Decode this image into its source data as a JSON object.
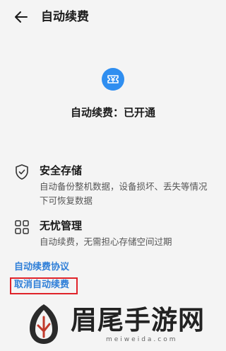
{
  "header": {
    "title": "自动续费",
    "back_icon": "arrow-left-icon"
  },
  "status": {
    "badge_icon": "ticket-yen-icon",
    "badge_color": "#2f8ef0",
    "text": "自动续费：已开通"
  },
  "features": [
    {
      "icon": "shield-check-icon",
      "title": "安全存储",
      "description": "自动备份整机数据，设备损坏、丢失等情况下可恢复数据"
    },
    {
      "icon": "grid-icon",
      "title": "无忧管理",
      "description": "自动续费，无需担心存储空间过期"
    }
  ],
  "links": {
    "agreement": "自动续费协议",
    "cancel": "取消自动续费",
    "link_color": "#2f7fd8",
    "highlight_color": "#e0232a"
  },
  "watermark": {
    "brand": "眉尾手游网",
    "url": "meiweida.com",
    "logo": "watermark-logo"
  }
}
